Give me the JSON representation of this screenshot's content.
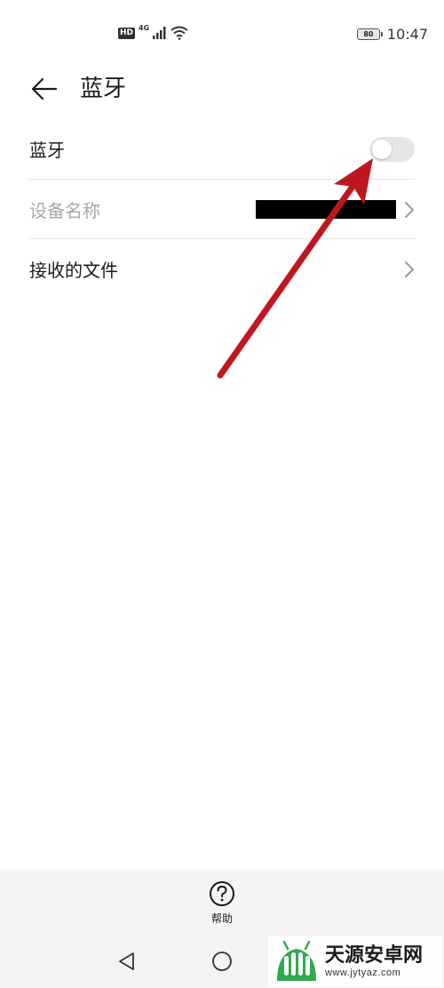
{
  "status_bar": {
    "hd_label": "HD",
    "network_label": "4G",
    "battery_level": "80",
    "time": "10:47"
  },
  "header": {
    "title": "蓝牙"
  },
  "settings": {
    "bluetooth": {
      "label": "蓝牙",
      "enabled": false
    },
    "device_name": {
      "label": "设备名称",
      "value": "[redacted]"
    },
    "received_files": {
      "label": "接收的文件"
    }
  },
  "bottom": {
    "help_label": "帮助"
  },
  "watermark": {
    "name": "天源安卓网",
    "url": "www.jytyaz.com"
  },
  "colors": {
    "annotation_arrow": "#c0161e",
    "toggle_off_track": "#e6e6e6",
    "watermark_green": "#2fa84f",
    "disabled_text": "#a8a8a8"
  }
}
